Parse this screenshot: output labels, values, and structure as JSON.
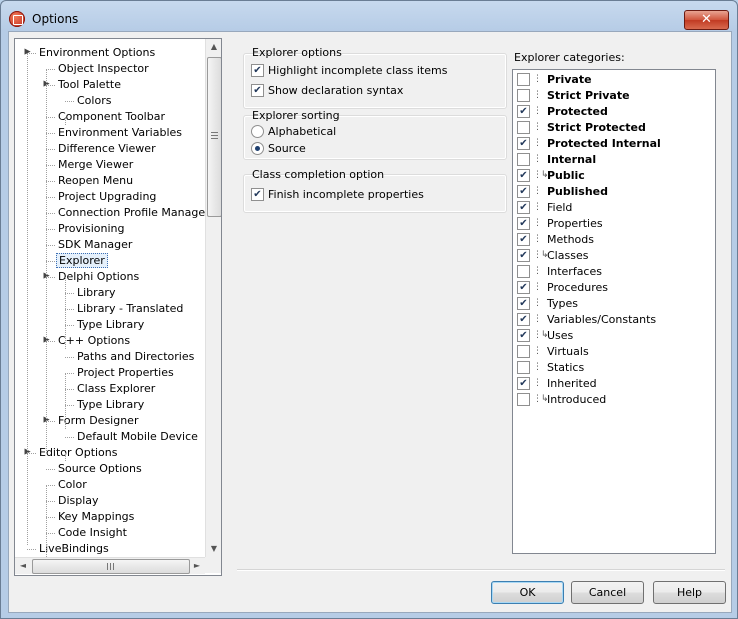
{
  "window": {
    "title": "Options",
    "close_label": "✕"
  },
  "tree": {
    "items": [
      {
        "label": "Environment Options",
        "level": 0,
        "expander": "▲"
      },
      {
        "label": "Object Inspector",
        "level": 1
      },
      {
        "label": "Tool Palette",
        "level": 1,
        "expander": "▲"
      },
      {
        "label": "Colors",
        "level": 2
      },
      {
        "label": "Component Toolbar",
        "level": 1
      },
      {
        "label": "Environment Variables",
        "level": 1
      },
      {
        "label": "Difference Viewer",
        "level": 1
      },
      {
        "label": "Merge Viewer",
        "level": 1
      },
      {
        "label": "Reopen Menu",
        "level": 1
      },
      {
        "label": "Project Upgrading",
        "level": 1
      },
      {
        "label": "Connection Profile Manager",
        "level": 1
      },
      {
        "label": "Provisioning",
        "level": 1
      },
      {
        "label": "SDK Manager",
        "level": 1
      },
      {
        "label": "Explorer",
        "level": 1,
        "selected": true
      },
      {
        "label": "Delphi Options",
        "level": 1,
        "expander": "▲"
      },
      {
        "label": "Library",
        "level": 2
      },
      {
        "label": "Library - Translated",
        "level": 2
      },
      {
        "label": "Type Library",
        "level": 2
      },
      {
        "label": "C++ Options",
        "level": 1,
        "expander": "▲"
      },
      {
        "label": "Paths and Directories",
        "level": 2
      },
      {
        "label": "Project Properties",
        "level": 2
      },
      {
        "label": "Class Explorer",
        "level": 2
      },
      {
        "label": "Type Library",
        "level": 2
      },
      {
        "label": "Form Designer",
        "level": 1,
        "expander": "▲"
      },
      {
        "label": "Default Mobile Device",
        "level": 2
      },
      {
        "label": "Editor Options",
        "level": 0,
        "expander": "▲"
      },
      {
        "label": "Source Options",
        "level": 1
      },
      {
        "label": "Color",
        "level": 1
      },
      {
        "label": "Display",
        "level": 1
      },
      {
        "label": "Key Mappings",
        "level": 1
      },
      {
        "label": "Code Insight",
        "level": 1
      },
      {
        "label": "LiveBindings",
        "level": 0
      }
    ]
  },
  "explorer_options": {
    "title": "Explorer options",
    "items": [
      {
        "label": "Highlight incomplete class items",
        "checked": true
      },
      {
        "label": "Show declaration syntax",
        "checked": true
      }
    ]
  },
  "explorer_sorting": {
    "title": "Explorer sorting",
    "items": [
      {
        "label": "Alphabetical",
        "selected": false
      },
      {
        "label": "Source",
        "selected": true
      }
    ]
  },
  "class_completion": {
    "title": "Class completion option",
    "items": [
      {
        "label": "Finish incomplete properties",
        "checked": true
      }
    ]
  },
  "categories": {
    "title": "Explorer categories:",
    "items": [
      {
        "label": "Private",
        "checked": false,
        "bold": true,
        "icon": "dots-icon"
      },
      {
        "label": "Strict Private",
        "checked": false,
        "bold": true,
        "icon": "dots-icon"
      },
      {
        "label": "Protected",
        "checked": true,
        "bold": true,
        "icon": "dots-icon"
      },
      {
        "label": "Strict Protected",
        "checked": false,
        "bold": true,
        "icon": "dots-icon"
      },
      {
        "label": "Protected Internal",
        "checked": true,
        "bold": true,
        "icon": "dots-icon"
      },
      {
        "label": "Internal",
        "checked": false,
        "bold": true,
        "icon": "dots-icon"
      },
      {
        "label": "Public",
        "checked": true,
        "bold": true,
        "icon": "branch-icon"
      },
      {
        "label": "Published",
        "checked": true,
        "bold": true,
        "icon": "dots-icon"
      },
      {
        "label": "Field",
        "checked": true,
        "bold": false,
        "icon": "dots-icon"
      },
      {
        "label": "Properties",
        "checked": true,
        "bold": false,
        "icon": "dots-icon"
      },
      {
        "label": "Methods",
        "checked": true,
        "bold": false,
        "icon": "dots-icon"
      },
      {
        "label": "Classes",
        "checked": true,
        "bold": false,
        "icon": "branch-icon"
      },
      {
        "label": "Interfaces",
        "checked": false,
        "bold": false,
        "icon": "dots-icon"
      },
      {
        "label": "Procedures",
        "checked": true,
        "bold": false,
        "icon": "dots-icon"
      },
      {
        "label": "Types",
        "checked": true,
        "bold": false,
        "icon": "dots-icon"
      },
      {
        "label": "Variables/Constants",
        "checked": true,
        "bold": false,
        "icon": "dots-icon"
      },
      {
        "label": "Uses",
        "checked": true,
        "bold": false,
        "icon": "branch-icon"
      },
      {
        "label": "Virtuals",
        "checked": false,
        "bold": false,
        "icon": "dots-icon"
      },
      {
        "label": "Statics",
        "checked": false,
        "bold": false,
        "icon": "dots-icon"
      },
      {
        "label": "Inherited",
        "checked": true,
        "bold": false,
        "icon": "dots-icon"
      },
      {
        "label": "Introduced",
        "checked": false,
        "bold": false,
        "icon": "branch-icon"
      }
    ]
  },
  "buttons": {
    "ok": "OK",
    "cancel": "Cancel",
    "help": "Help"
  },
  "scroll": {
    "up": "▲",
    "down": "▼",
    "left": "◄",
    "right": "►"
  },
  "glyphs": {
    "check": "✔",
    "dots": "⋮",
    "branch": "⋮↳"
  }
}
